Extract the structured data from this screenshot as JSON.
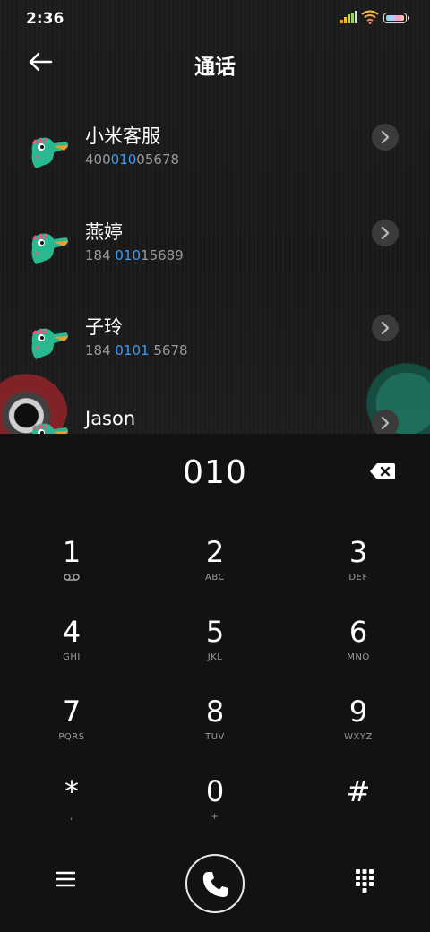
{
  "status": {
    "time": "2:36"
  },
  "header": {
    "title": "通话"
  },
  "contacts": [
    {
      "name": "小米客服",
      "num_pre": "400",
      "num_hl": "010",
      "num_post": "05678"
    },
    {
      "name": "燕婷",
      "num_pre": "184 ",
      "num_hl": "010",
      "num_post": "15689"
    },
    {
      "name": "子玲",
      "num_pre": "184 ",
      "num_hl": "0101",
      "num_post": " 5678"
    },
    {
      "name": "Jason",
      "num_pre": "",
      "num_hl": "",
      "num_post": ""
    }
  ],
  "dialer": {
    "entry": "010",
    "keys": [
      {
        "digit": "1",
        "sub": ""
      },
      {
        "digit": "2",
        "sub": "ABC"
      },
      {
        "digit": "3",
        "sub": "DEF"
      },
      {
        "digit": "4",
        "sub": "GHI"
      },
      {
        "digit": "5",
        "sub": "JKL"
      },
      {
        "digit": "6",
        "sub": "MNO"
      },
      {
        "digit": "7",
        "sub": "PQRS"
      },
      {
        "digit": "8",
        "sub": "TUV"
      },
      {
        "digit": "9",
        "sub": "WXYZ"
      },
      {
        "digit": "*",
        "sub": ","
      },
      {
        "digit": "0",
        "sub": "+"
      },
      {
        "digit": "#",
        "sub": ""
      }
    ]
  },
  "icons": {
    "back": "arrow-left-icon",
    "delete": "backspace-icon",
    "menu": "menu-icon",
    "call": "phone-icon",
    "keypad": "dialpad-icon",
    "voicemail": "voicemail-icon",
    "chevron": "chevron-right-icon"
  },
  "colors": {
    "highlight": "#3d9bf0",
    "background": "#121212"
  }
}
